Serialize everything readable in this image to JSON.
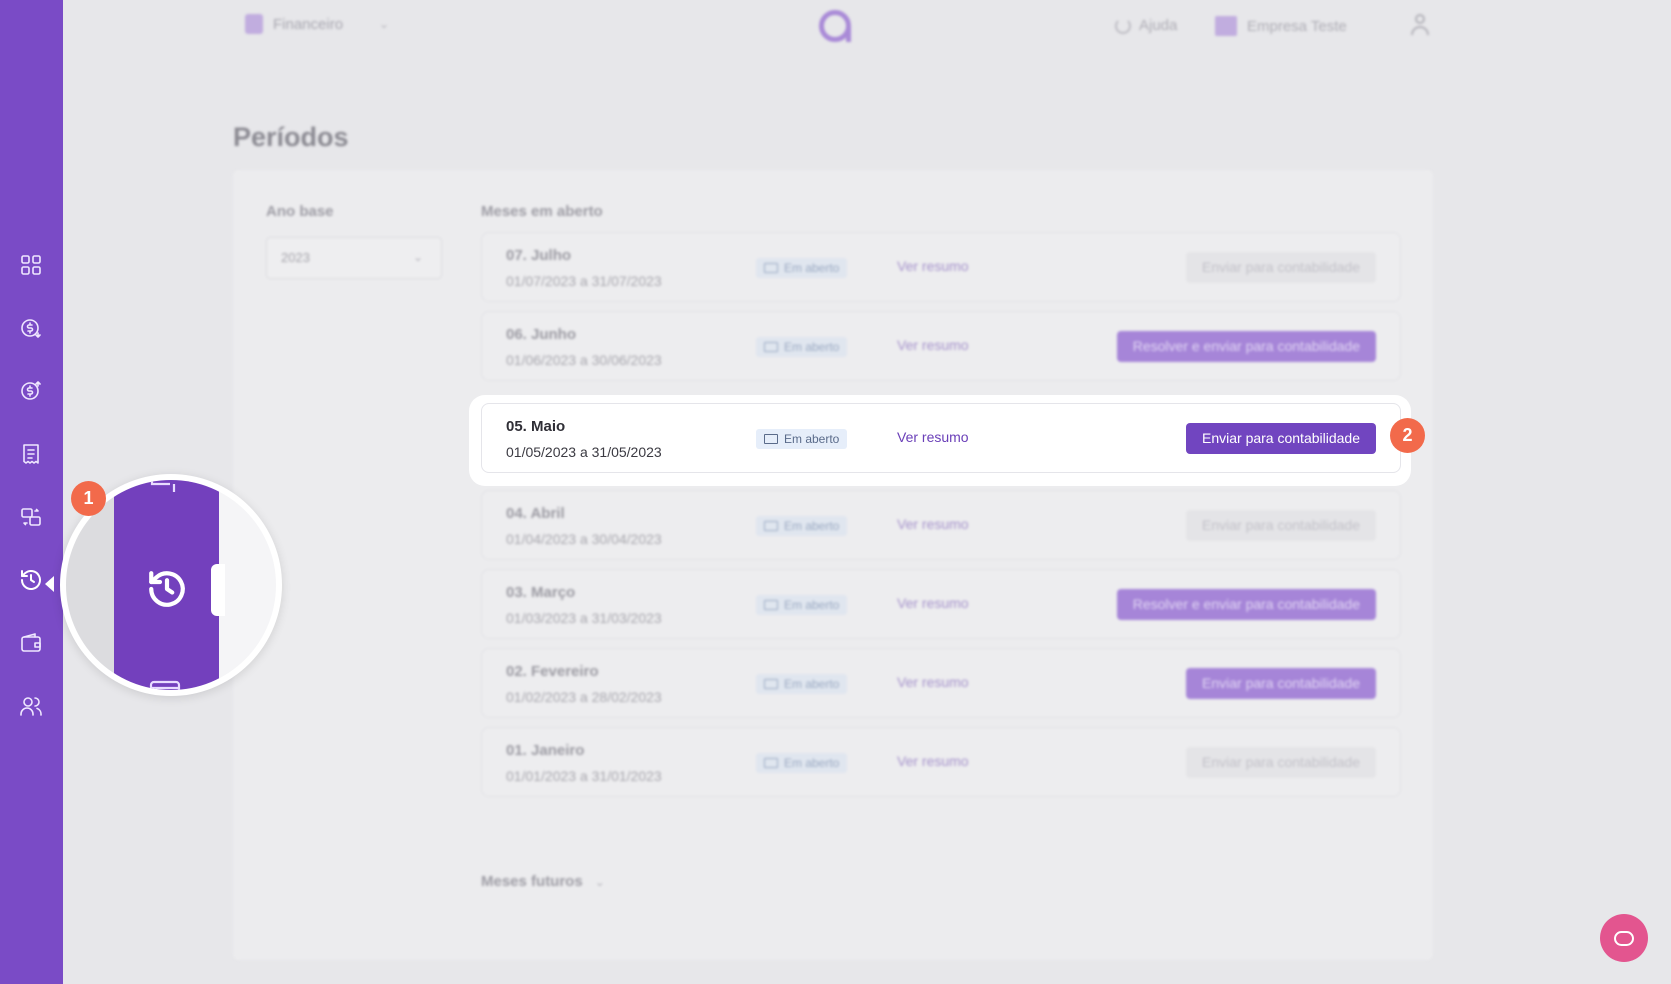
{
  "header": {
    "module_label": "Financeiro",
    "help_label": "Ajuda",
    "company_label": "Empresa Teste"
  },
  "page": {
    "title": "Períodos",
    "year_label": "Ano base",
    "year_value": "2023",
    "open_months_label": "Meses em aberto",
    "future_months_label": "Meses futuros"
  },
  "months": [
    {
      "name": "07. Julho",
      "dates": "01/07/2023 a 31/07/2023",
      "status": "Em aberto",
      "link": "Ver resumo",
      "action": "Enviar para contabilidade",
      "action_state": "disabled"
    },
    {
      "name": "06. Junho",
      "dates": "01/06/2023 a 30/06/2023",
      "status": "Em aberto",
      "link": "Ver resumo",
      "action": "Resolver e enviar para contabilidade",
      "action_state": "enabled"
    },
    {
      "name": "05. Maio",
      "dates": "01/05/2023 a 31/05/2023",
      "status": "Em aberto",
      "link": "Ver resumo",
      "action": "Enviar para contabilidade",
      "action_state": "enabled",
      "highlighted": true
    },
    {
      "name": "04. Abril",
      "dates": "01/04/2023 a 30/04/2023",
      "status": "Em aberto",
      "link": "Ver resumo",
      "action": "Enviar para contabilidade",
      "action_state": "disabled"
    },
    {
      "name": "03. Março",
      "dates": "01/03/2023 a 31/03/2023",
      "status": "Em aberto",
      "link": "Ver resumo",
      "action": "Resolver e enviar para contabilidade",
      "action_state": "enabled"
    },
    {
      "name": "02. Fevereiro",
      "dates": "01/02/2023 a 28/02/2023",
      "status": "Em aberto",
      "link": "Ver resumo",
      "action": "Enviar para contabilidade",
      "action_state": "enabled"
    },
    {
      "name": "01. Janeiro",
      "dates": "01/01/2023 a 31/01/2023",
      "status": "Em aberto",
      "link": "Ver resumo",
      "action": "Enviar para contabilidade",
      "action_state": "disabled"
    }
  ],
  "steps": {
    "step1": "1",
    "step2": "2"
  },
  "sidebar": {
    "icons": [
      "dashboard-icon",
      "money-in-icon",
      "money-out-icon",
      "receipt-icon",
      "transfer-icon",
      "history-icon",
      "wallet-icon",
      "users-icon"
    ],
    "active": "history-icon"
  },
  "colors": {
    "sidebar": "#7a4bc6",
    "primary_button": "#7145c0",
    "step_badge": "#f26a4b",
    "chat_button": "#e3558f"
  }
}
